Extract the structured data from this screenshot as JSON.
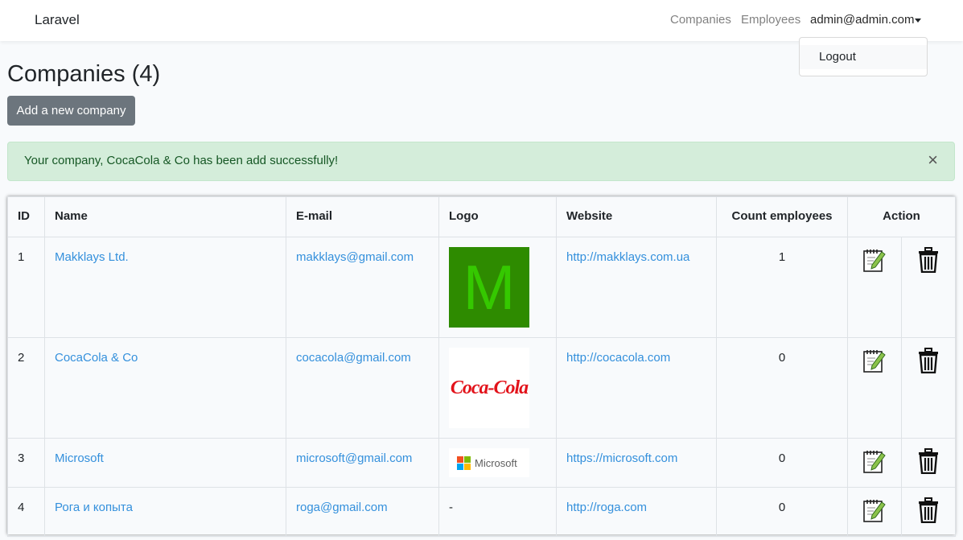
{
  "nav": {
    "brand": "Laravel",
    "companies": "Companies",
    "employees": "Employees",
    "user": "admin@admin.com",
    "logout": "Logout"
  },
  "page": {
    "title": "Companies (4)",
    "add_button": "Add a new company"
  },
  "alert": {
    "message": "Your company, CocaCola & Co has been add successfully!",
    "close": "×"
  },
  "table": {
    "headers": {
      "id": "ID",
      "name": "Name",
      "email": "E-mail",
      "logo": "Logo",
      "website": "Website",
      "count": "Count employees",
      "action": "Action"
    },
    "rows": [
      {
        "id": "1",
        "name": "Makklays Ltd.",
        "email": "makklays@gmail.com",
        "logo": "M",
        "website": "http://makklays.com.ua",
        "count": "1"
      },
      {
        "id": "2",
        "name": "CocaCola & Co",
        "email": "cocacola@gmail.com",
        "logo": "Coca-Cola",
        "website": "http://cocacola.com",
        "count": "0"
      },
      {
        "id": "3",
        "name": "Microsoft",
        "email": "microsoft@gmail.com",
        "logo": "Microsoft",
        "website": "https://microsoft.com",
        "count": "0"
      },
      {
        "id": "4",
        "name": "Рога и копыта",
        "email": "roga@gmail.com",
        "logo": "-",
        "website": "http://roga.com",
        "count": "0"
      }
    ]
  },
  "icons": {
    "edit": "edit-icon",
    "delete": "trash-icon"
  },
  "colors": {
    "link": "#3490dc",
    "alert_bg": "#d4edda",
    "alert_text": "#155724",
    "button_bg": "#6c757d"
  }
}
